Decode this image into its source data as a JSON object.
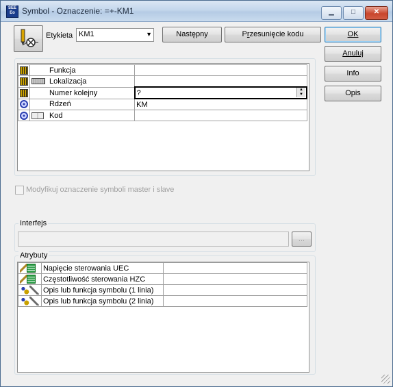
{
  "window": {
    "icon_text": "SEE Eo",
    "title": "Symbol - Oznaczenie: =+-KM1",
    "minimize_glyph": "▁",
    "maximize_glyph": "□",
    "close_glyph": "✕"
  },
  "top": {
    "etykieta_label": "Etykieta",
    "etykieta_value": "KM1",
    "dropdown_glyph": "▼",
    "next_button": "Następny",
    "offset_button_pre": "P",
    "offset_button_ul": "r",
    "offset_button_post": "zesunięcie kodu"
  },
  "side_buttons": {
    "ok": "OK",
    "cancel": "Anuluj",
    "info": "Info",
    "opis": "Opis"
  },
  "designation_grid": {
    "rows": [
      {
        "icon": "building-icon",
        "sub_icon": "",
        "label": "Funkcja",
        "value": ""
      },
      {
        "icon": "building-icon",
        "sub_icon": "keyboard-icon",
        "label": "Lokalizacja",
        "value": ""
      },
      {
        "icon": "building-icon",
        "sub_icon": "",
        "label": "Numer kolejny",
        "value": "?"
      },
      {
        "icon": "target-icon",
        "sub_icon": "",
        "label": "Rdzeń",
        "value": "KM"
      },
      {
        "icon": "target-icon",
        "sub_icon": "book-icon",
        "label": "Kod",
        "value": ""
      }
    ],
    "spinner_up": "▲",
    "spinner_down": "▼"
  },
  "checkbox": {
    "label": "Modyfikuj oznaczenie symboli master i slave",
    "checked": false
  },
  "interfejs": {
    "label": "Interfejs",
    "value": "",
    "browse_label": "..."
  },
  "atrybuty": {
    "label": "Atrybuty",
    "rows": [
      {
        "icons": [
          "pencil-icon",
          "table-icon"
        ],
        "label": "Napięcie sterowania UEC",
        "value": ""
      },
      {
        "icons": [
          "pencil-icon",
          "table-icon"
        ],
        "label": "Częstotliwość sterowania HZC",
        "value": ""
      },
      {
        "icons": [
          "people-icon",
          "plug-icon"
        ],
        "label": "Opis lub funkcja symbolu (1 linia)",
        "value": ""
      },
      {
        "icons": [
          "people-icon",
          "plug-icon"
        ],
        "label": "Opis lub funkcja symbolu (2 linia)",
        "value": ""
      }
    ]
  }
}
